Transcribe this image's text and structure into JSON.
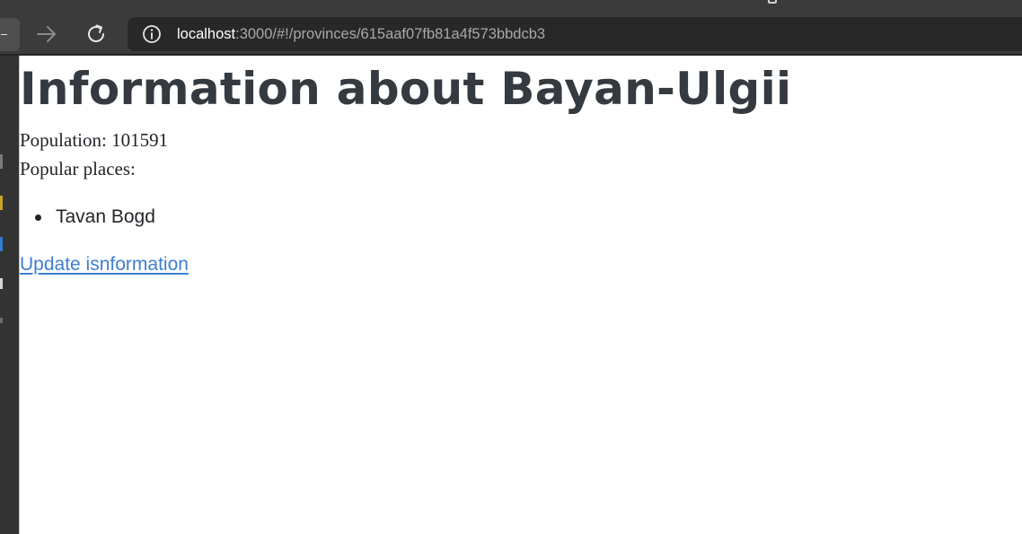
{
  "browser": {
    "url_host": "localhost",
    "url_rest": ":3000/#!/provinces/615aaf07fb81a4f573bbdcb3"
  },
  "page": {
    "title": "Information about Bayan-Ulgii",
    "population_label": "Population: 101591",
    "popular_places_label": "Popular places:",
    "popular_places": [
      "Tavan Bogd"
    ],
    "update_link": "Update isnformation"
  },
  "colors": {
    "link": "#3f7fcf",
    "heading": "#343a40",
    "browser_chrome": "#3b3b3b"
  }
}
